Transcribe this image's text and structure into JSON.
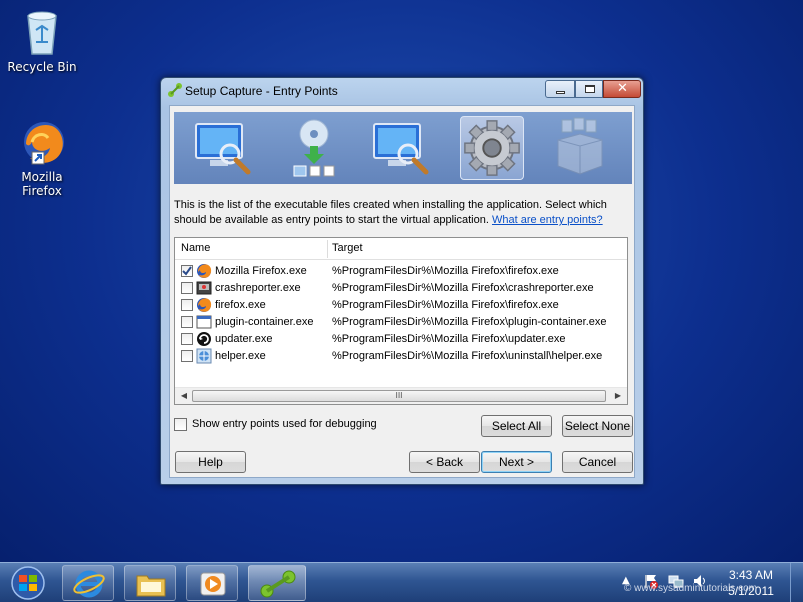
{
  "desktop": {
    "icons": [
      {
        "label": "Recycle Bin",
        "icon": "recycle-bin-icon"
      },
      {
        "label": "Mozilla Firefox",
        "icon": "firefox-shortcut-icon"
      }
    ]
  },
  "window": {
    "title": "Setup Capture - Entry Points",
    "steps": [
      "monitor-scan-icon",
      "disc-install-icon",
      "monitor-scan-icon",
      "gear-icon",
      "package-box-icon"
    ],
    "active_step": 3,
    "description": "This is the list of the executable files created when installing the application. Select which should be available as entry points to start the virtual application.",
    "help_link": "What are entry points?",
    "list": {
      "columns": [
        "Name",
        "Target"
      ],
      "rows": [
        {
          "name": "Mozilla Firefox.exe",
          "target": "%ProgramFilesDir%\\Mozilla Firefox\\firefox.exe",
          "checked": true,
          "icon": "firefox-icon"
        },
        {
          "name": "crashreporter.exe",
          "target": "%ProgramFilesDir%\\Mozilla Firefox\\crashreporter.exe",
          "checked": false,
          "icon": "crashreporter-icon"
        },
        {
          "name": "firefox.exe",
          "target": "%ProgramFilesDir%\\Mozilla Firefox\\firefox.exe",
          "checked": false,
          "icon": "firefox-icon"
        },
        {
          "name": "plugin-container.exe",
          "target": "%ProgramFilesDir%\\Mozilla Firefox\\plugin-container.exe",
          "checked": false,
          "icon": "window-app-icon"
        },
        {
          "name": "updater.exe",
          "target": "%ProgramFilesDir%\\Mozilla Firefox\\updater.exe",
          "checked": false,
          "icon": "updater-icon"
        },
        {
          "name": "helper.exe",
          "target": "%ProgramFilesDir%\\Mozilla Firefox\\uninstall\\helper.exe",
          "checked": false,
          "icon": "globe-app-icon"
        }
      ],
      "scroll_grip": "III"
    },
    "debug_checkbox_label": "Show entry points used for debugging",
    "buttons": {
      "select_all": "Select All",
      "select_none": "Select None",
      "help": "Help",
      "back": "< Back",
      "next": "Next >",
      "cancel": "Cancel"
    }
  },
  "taskbar": {
    "items": [
      "start-orb-icon",
      "internet-explorer-icon",
      "explorer-folder-icon",
      "media-player-icon",
      "thinapp-capture-icon"
    ],
    "clock_time": "3:43 AM",
    "clock_date": "5/1/2011",
    "watermark": "© www.sysadmintutorials.com"
  },
  "colors": {
    "accent": "#3c7fb1",
    "link": "#0a50c8",
    "taskbar": "#2f5592"
  }
}
